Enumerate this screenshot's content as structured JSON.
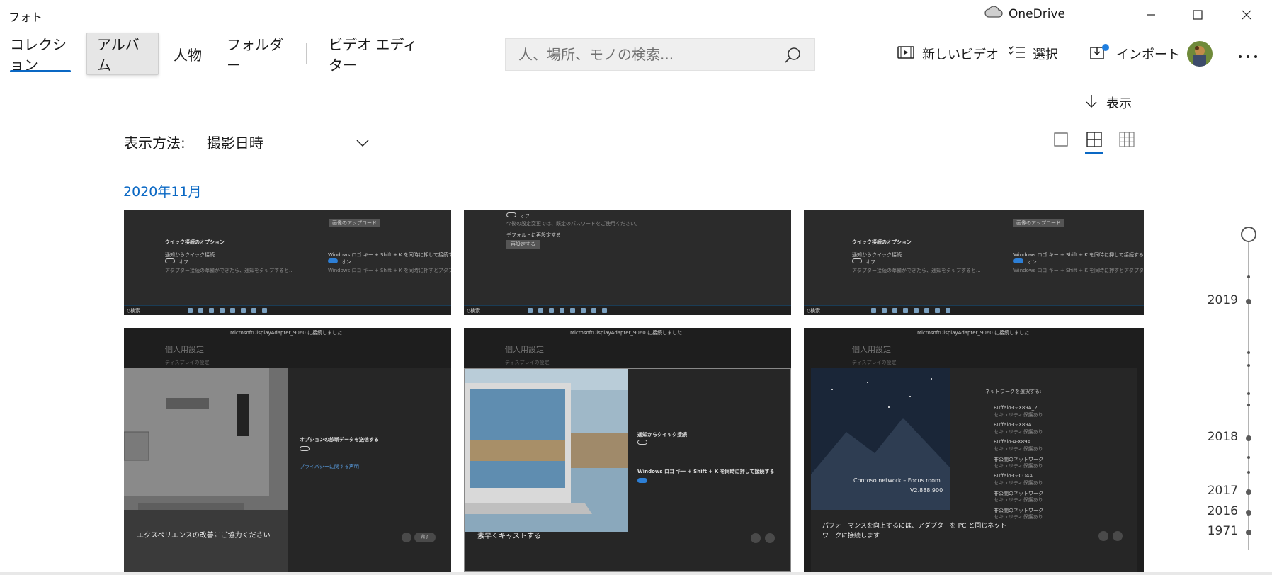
{
  "window": {
    "app_title": "フォト",
    "onedrive_label": "OneDrive"
  },
  "nav": {
    "tabs": [
      {
        "label": "コレクション",
        "state": "active"
      },
      {
        "label": "アルバム",
        "state": "hovered"
      },
      {
        "label": "人物",
        "state": "normal"
      },
      {
        "label": "フォルダー",
        "state": "normal"
      },
      {
        "label": "ビデオ エディター",
        "state": "normal"
      }
    ]
  },
  "search": {
    "placeholder": "人、場所、モノの検索..."
  },
  "commands": {
    "new_video": "新しいビデオ",
    "select": "選択",
    "import": "インポート"
  },
  "toolbar": {
    "show_label": "表示",
    "sort_label": "表示方法:",
    "sort_value": "撮影日時",
    "view_modes": [
      "single",
      "medium-grid",
      "small-grid"
    ],
    "selected_view": "medium-grid"
  },
  "section": {
    "month_label": "2020年11月"
  },
  "thumbnails": {
    "row1": {
      "quick_connect_heading": "クイック接続のオプション",
      "notify_quick_connect": "通知からクイック接続",
      "notify_desc": "アダプター接続の準備ができたら、通知をタップすると...",
      "winkey_label": "Windows ロゴ キー + Shift + K を同時に押して接続する",
      "winkey_desc": "Windows ロゴ キー + Shift + K を同時に押すとアダプターに接続...",
      "toggle_off": "オフ",
      "toggle_on": "オン",
      "update_button": "画像のアップロード",
      "reset_heading": "デフォルトに再設定する",
      "reset_button": "再設定する",
      "reset_desc": "今後の設定変更では、既定のパスワードをご使用ください。",
      "taskbar_search": "で検索"
    },
    "row2": {
      "connected_banner": "MicrosoftDisplayAdapter_9060 に接続しました",
      "personal_settings": "個人用設定",
      "display_settings": "ディスプレイの設定",
      "thumb1_caption": "エクスペリエンスの改善にご協力ください",
      "thumb1_heading": "オプションの診断データを送信する",
      "thumb1_link": "プライバシーに関する声明",
      "done_button": "完了",
      "thumb2_caption": "素早くキャストする",
      "thumb2_heading1": "通知からクイック接続",
      "thumb2_heading2": "Windows ロゴ キー + Shift + K を同時に押して接続する",
      "thumb3_network_title": "Contoso network – Focus room",
      "thumb3_version": "V2.888.900",
      "thumb3_caption_line1": "パフォーマンスを向上するには、アダプターを PC と同じネット",
      "thumb3_caption_line2": "ワークに接続します",
      "thumb3_select_network": "ネットワークを選択する:",
      "thumb3_networks": [
        "Buffalo-G-X89A_2",
        "Buffalo-G-X89A",
        "Buffalo-A-X89A",
        "非公開のネットワーク",
        "Buffalo-G-CO4A",
        "非公開のネットワーク",
        "非公開のネットワーク"
      ],
      "thumb3_network_sub": "セキュリティ保護あり"
    }
  },
  "timeline": {
    "years": [
      "2019",
      "2018",
      "2017",
      "2016",
      "1971"
    ]
  },
  "colors": {
    "accent": "#0a68c4",
    "thumb_bg": "#2b2b2b"
  }
}
